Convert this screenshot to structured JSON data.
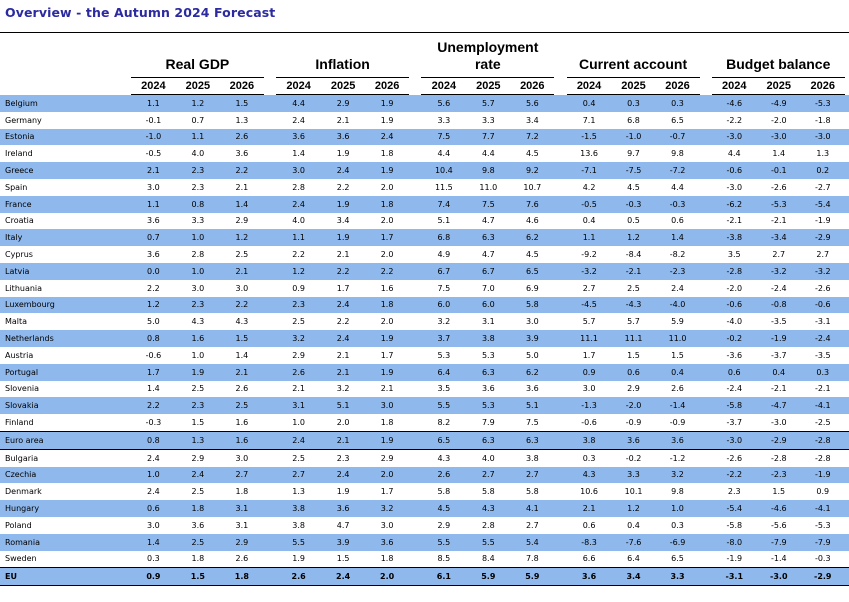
{
  "title": "Overview - the Autumn 2024 Forecast",
  "groups": [
    "Real GDP",
    "Inflation",
    "Unemployment rate",
    "Current account",
    "Budget balance"
  ],
  "years": [
    "2024",
    "2025",
    "2026"
  ],
  "rows": [
    {
      "country": "Belgium",
      "values": [
        "1.1",
        "1.2",
        "1.5",
        "4.4",
        "2.9",
        "1.9",
        "5.6",
        "5.7",
        "5.6",
        "0.4",
        "0.3",
        "0.3",
        "-4.6",
        "-4.9",
        "-5.3"
      ],
      "hl": true
    },
    {
      "country": "Germany",
      "values": [
        "-0.1",
        "0.7",
        "1.3",
        "2.4",
        "2.1",
        "1.9",
        "3.3",
        "3.3",
        "3.4",
        "7.1",
        "6.8",
        "6.5",
        "-2.2",
        "-2.0",
        "-1.8"
      ],
      "hl": false
    },
    {
      "country": "Estonia",
      "values": [
        "-1.0",
        "1.1",
        "2.6",
        "3.6",
        "3.6",
        "2.4",
        "7.5",
        "7.7",
        "7.2",
        "-1.5",
        "-1.0",
        "-0.7",
        "-3.0",
        "-3.0",
        "-3.0"
      ],
      "hl": true
    },
    {
      "country": "Ireland",
      "values": [
        "-0.5",
        "4.0",
        "3.6",
        "1.4",
        "1.9",
        "1.8",
        "4.4",
        "4.4",
        "4.5",
        "13.6",
        "9.7",
        "9.8",
        "4.4",
        "1.4",
        "1.3"
      ],
      "hl": false
    },
    {
      "country": "Greece",
      "values": [
        "2.1",
        "2.3",
        "2.2",
        "3.0",
        "2.4",
        "1.9",
        "10.4",
        "9.8",
        "9.2",
        "-7.1",
        "-7.5",
        "-7.2",
        "-0.6",
        "-0.1",
        "0.2"
      ],
      "hl": true
    },
    {
      "country": "Spain",
      "values": [
        "3.0",
        "2.3",
        "2.1",
        "2.8",
        "2.2",
        "2.0",
        "11.5",
        "11.0",
        "10.7",
        "4.2",
        "4.5",
        "4.4",
        "-3.0",
        "-2.6",
        "-2.7"
      ],
      "hl": false
    },
    {
      "country": "France",
      "values": [
        "1.1",
        "0.8",
        "1.4",
        "2.4",
        "1.9",
        "1.8",
        "7.4",
        "7.5",
        "7.6",
        "-0.5",
        "-0.3",
        "-0.3",
        "-6.2",
        "-5.3",
        "-5.4"
      ],
      "hl": true
    },
    {
      "country": "Croatia",
      "values": [
        "3.6",
        "3.3",
        "2.9",
        "4.0",
        "3.4",
        "2.0",
        "5.1",
        "4.7",
        "4.6",
        "0.4",
        "0.5",
        "0.6",
        "-2.1",
        "-2.1",
        "-1.9"
      ],
      "hl": false
    },
    {
      "country": "Italy",
      "values": [
        "0.7",
        "1.0",
        "1.2",
        "1.1",
        "1.9",
        "1.7",
        "6.8",
        "6.3",
        "6.2",
        "1.1",
        "1.2",
        "1.4",
        "-3.8",
        "-3.4",
        "-2.9"
      ],
      "hl": true
    },
    {
      "country": "Cyprus",
      "values": [
        "3.6",
        "2.8",
        "2.5",
        "2.2",
        "2.1",
        "2.0",
        "4.9",
        "4.7",
        "4.5",
        "-9.2",
        "-8.4",
        "-8.2",
        "3.5",
        "2.7",
        "2.7"
      ],
      "hl": false
    },
    {
      "country": "Latvia",
      "values": [
        "0.0",
        "1.0",
        "2.1",
        "1.2",
        "2.2",
        "2.2",
        "6.7",
        "6.7",
        "6.5",
        "-3.2",
        "-2.1",
        "-2.3",
        "-2.8",
        "-3.2",
        "-3.2"
      ],
      "hl": true
    },
    {
      "country": "Lithuania",
      "values": [
        "2.2",
        "3.0",
        "3.0",
        "0.9",
        "1.7",
        "1.6",
        "7.5",
        "7.0",
        "6.9",
        "2.7",
        "2.5",
        "2.4",
        "-2.0",
        "-2.4",
        "-2.6"
      ],
      "hl": false
    },
    {
      "country": "Luxembourg",
      "values": [
        "1.2",
        "2.3",
        "2.2",
        "2.3",
        "2.4",
        "1.8",
        "6.0",
        "6.0",
        "5.8",
        "-4.5",
        "-4.3",
        "-4.0",
        "-0.6",
        "-0.8",
        "-0.6"
      ],
      "hl": true
    },
    {
      "country": "Malta",
      "values": [
        "5.0",
        "4.3",
        "4.3",
        "2.5",
        "2.2",
        "2.0",
        "3.2",
        "3.1",
        "3.0",
        "5.7",
        "5.7",
        "5.9",
        "-4.0",
        "-3.5",
        "-3.1"
      ],
      "hl": false
    },
    {
      "country": "Netherlands",
      "values": [
        "0.8",
        "1.6",
        "1.5",
        "3.2",
        "2.4",
        "1.9",
        "3.7",
        "3.8",
        "3.9",
        "11.1",
        "11.1",
        "11.0",
        "-0.2",
        "-1.9",
        "-2.4"
      ],
      "hl": true
    },
    {
      "country": "Austria",
      "values": [
        "-0.6",
        "1.0",
        "1.4",
        "2.9",
        "2.1",
        "1.7",
        "5.3",
        "5.3",
        "5.0",
        "1.7",
        "1.5",
        "1.5",
        "-3.6",
        "-3.7",
        "-3.5"
      ],
      "hl": false
    },
    {
      "country": "Portugal",
      "values": [
        "1.7",
        "1.9",
        "2.1",
        "2.6",
        "2.1",
        "1.9",
        "6.4",
        "6.3",
        "6.2",
        "0.9",
        "0.6",
        "0.4",
        "0.6",
        "0.4",
        "0.3"
      ],
      "hl": true
    },
    {
      "country": "Slovenia",
      "values": [
        "1.4",
        "2.5",
        "2.6",
        "2.1",
        "3.2",
        "2.1",
        "3.5",
        "3.6",
        "3.6",
        "3.0",
        "2.9",
        "2.6",
        "-2.4",
        "-2.1",
        "-2.1"
      ],
      "hl": false
    },
    {
      "country": "Slovakia",
      "values": [
        "2.2",
        "2.3",
        "2.5",
        "3.1",
        "5.1",
        "3.0",
        "5.5",
        "5.3",
        "5.1",
        "-1.3",
        "-2.0",
        "-1.4",
        "-5.8",
        "-4.7",
        "-4.1"
      ],
      "hl": true
    },
    {
      "country": "Finland",
      "values": [
        "-0.3",
        "1.5",
        "1.6",
        "1.0",
        "2.0",
        "1.8",
        "8.2",
        "7.9",
        "7.5",
        "-0.6",
        "-0.9",
        "-0.9",
        "-3.7",
        "-3.0",
        "-2.5"
      ],
      "hl": false
    },
    {
      "country": "Euro area",
      "values": [
        "0.8",
        "1.3",
        "1.6",
        "2.4",
        "2.1",
        "1.9",
        "6.5",
        "6.3",
        "6.3",
        "3.8",
        "3.6",
        "3.6",
        "-3.0",
        "-2.9",
        "-2.8"
      ],
      "hl": true,
      "ea": true
    },
    {
      "country": "Bulgaria",
      "values": [
        "2.4",
        "2.9",
        "3.0",
        "2.5",
        "2.3",
        "2.9",
        "4.3",
        "4.0",
        "3.8",
        "0.3",
        "-0.2",
        "-1.2",
        "-2.6",
        "-2.8",
        "-2.8"
      ],
      "hl": false
    },
    {
      "country": "Czechia",
      "values": [
        "1.0",
        "2.4",
        "2.7",
        "2.7",
        "2.4",
        "2.0",
        "2.6",
        "2.7",
        "2.7",
        "4.3",
        "3.3",
        "3.2",
        "-2.2",
        "-2.3",
        "-1.9"
      ],
      "hl": true
    },
    {
      "country": "Denmark",
      "values": [
        "2.4",
        "2.5",
        "1.8",
        "1.3",
        "1.9",
        "1.7",
        "5.8",
        "5.8",
        "5.8",
        "10.6",
        "10.1",
        "9.8",
        "2.3",
        "1.5",
        "0.9"
      ],
      "hl": false
    },
    {
      "country": "Hungary",
      "values": [
        "0.6",
        "1.8",
        "3.1",
        "3.8",
        "3.6",
        "3.2",
        "4.5",
        "4.3",
        "4.1",
        "2.1",
        "1.2",
        "1.0",
        "-5.4",
        "-4.6",
        "-4.1"
      ],
      "hl": true
    },
    {
      "country": "Poland",
      "values": [
        "3.0",
        "3.6",
        "3.1",
        "3.8",
        "4.7",
        "3.0",
        "2.9",
        "2.8",
        "2.7",
        "0.6",
        "0.4",
        "0.3",
        "-5.8",
        "-5.6",
        "-5.3"
      ],
      "hl": false
    },
    {
      "country": "Romania",
      "values": [
        "1.4",
        "2.5",
        "2.9",
        "5.5",
        "3.9",
        "3.6",
        "5.5",
        "5.5",
        "5.4",
        "-8.3",
        "-7.6",
        "-6.9",
        "-8.0",
        "-7.9",
        "-7.9"
      ],
      "hl": true
    },
    {
      "country": "Sweden",
      "values": [
        "0.3",
        "1.8",
        "2.6",
        "1.9",
        "1.5",
        "1.8",
        "8.5",
        "8.4",
        "7.8",
        "6.6",
        "6.4",
        "6.5",
        "-1.9",
        "-1.4",
        "-0.3"
      ],
      "hl": false
    },
    {
      "country": "EU",
      "values": [
        "0.9",
        "1.5",
        "1.8",
        "2.6",
        "2.4",
        "2.0",
        "6.1",
        "5.9",
        "5.9",
        "3.6",
        "3.4",
        "3.3",
        "-3.1",
        "-3.0",
        "-2.9"
      ],
      "hl": true,
      "eu": true
    }
  ]
}
